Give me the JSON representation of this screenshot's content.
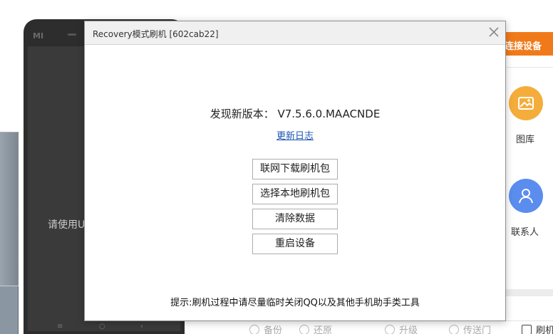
{
  "background": {
    "phone_prompt": "请使用U",
    "phone_logo": "MI",
    "nav_keys": [
      "≡",
      "○",
      "‹"
    ],
    "connect_button": "连接设备",
    "right_items": [
      {
        "label": "图库",
        "icon": "image-icon",
        "color": "#f4ad3b"
      },
      {
        "label": "联系人",
        "icon": "person-icon",
        "color": "#5b8def"
      }
    ],
    "bottom_bar": {
      "backup": "备份",
      "restore": "还原",
      "upgrade": "升级",
      "transfer": "传送门",
      "flash": "刷机"
    },
    "accent_color": "#f07a1a"
  },
  "dialog": {
    "title": "Recovery模式刷机 [602cab22]",
    "version_text": "发现新版本： V7.5.6.0.MAACNDE",
    "changelog_link": "更新日志",
    "buttons": {
      "online_download": "联网下载刷机包",
      "local_package": "选择本地刷机包",
      "wipe_data": "清除数据",
      "reboot": "重启设备"
    },
    "hint": "提示:刷机过程中请尽量临时关闭QQ以及其他手机助手类工具"
  }
}
